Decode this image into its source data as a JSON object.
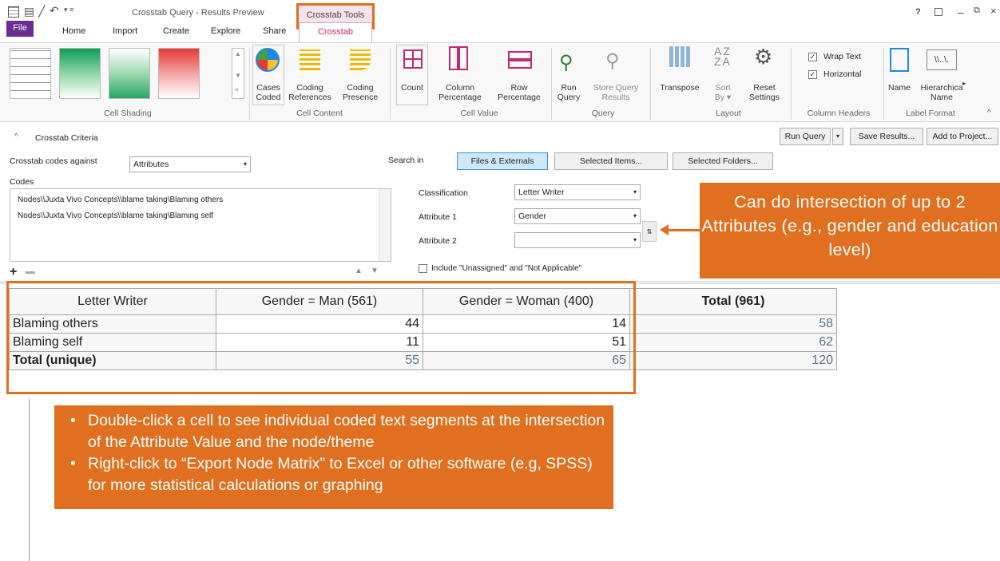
{
  "window": {
    "title": "Crosstab Query - Results Preview",
    "context_tab_group": "Crosstab Tools",
    "help": "?",
    "minimize": "–",
    "restore": "⧉",
    "close": "×"
  },
  "menu": [
    "File",
    "Home",
    "Import",
    "Create",
    "Explore",
    "Share",
    "Crosstab"
  ],
  "ribbon": {
    "cell_shading": "Cell Shading",
    "cases_coded": [
      "Cases",
      "Coded"
    ],
    "coding_references": [
      "Coding",
      "References"
    ],
    "coding_presence": [
      "Coding",
      "Presence"
    ],
    "cell_content": "Cell Content",
    "count": "Count",
    "column_percentage": [
      "Column",
      "Percentage"
    ],
    "row_percentage": [
      "Row",
      "Percentage"
    ],
    "cell_value": "Cell Value",
    "run_query": [
      "Run",
      "Query"
    ],
    "store_query_results": [
      "Store Query",
      "Results"
    ],
    "query": "Query",
    "transpose": "Transpose",
    "sort_by": [
      "Sort",
      "By ▾"
    ],
    "reset_settings": [
      "Reset",
      "Settings"
    ],
    "layout": "Layout",
    "wrap_text": "Wrap Text",
    "horizontal": "Horizontal",
    "column_headers": "Column Headers",
    "name": "Name",
    "hierarchical_name": [
      "Hierarchica",
      "Name"
    ],
    "label_format": "Label Format"
  },
  "criteria": {
    "header": "Crosstab Criteria",
    "run_query": "Run Query",
    "save_results": "Save Results...",
    "add_to_project": "Add to Project...",
    "crosstab_label": "Crosstab codes against",
    "crosstab_value": "Attributes",
    "search_in": "Search in",
    "files_externals": "Files & Externals",
    "selected_items": "Selected Items...",
    "selected_folders": "Selected Folders...",
    "codes_label": "Codes",
    "codes": [
      "Nodes\\\\Juxta Vivo Concepts\\\\blame taking\\Blaming others",
      "Nodes\\\\Juxta Vivo Concepts\\\\blame taking\\Blaming self"
    ],
    "classification_label": "Classification",
    "classification_value": "Letter Writer",
    "attribute1_label": "Attribute 1",
    "attribute1_value": "Gender",
    "attribute2_label": "Attribute 2",
    "attribute2_value": "",
    "include_unassigned": "Include \"Unassigned\" and \"Not Applicable\""
  },
  "results": {
    "headers": [
      "Letter Writer",
      "Gender = Man (561)",
      "Gender = Woman (400)",
      "Total (961)"
    ],
    "rows": [
      [
        "Blaming others",
        "44",
        "14",
        "58"
      ],
      [
        "Blaming self",
        "11",
        "51",
        "62"
      ],
      [
        "Total (unique)",
        "55",
        "65",
        "120"
      ]
    ]
  },
  "callouts": {
    "attributes": "Can do intersection of up to 2 Attributes (e.g., gender and education level)",
    "bullet1": "Double-click a cell to see individual coded text segments at the intersection of the Attribute Value and the node/theme",
    "bullet2": "Right-click to “Export Node Matrix” to Excel or other software (e.g, SPSS) for more statistical calculations or graphing"
  },
  "colors": {
    "accent_orange": "#e07020",
    "file_purple": "#6a2c91",
    "tab_pink": "#c4286e"
  }
}
